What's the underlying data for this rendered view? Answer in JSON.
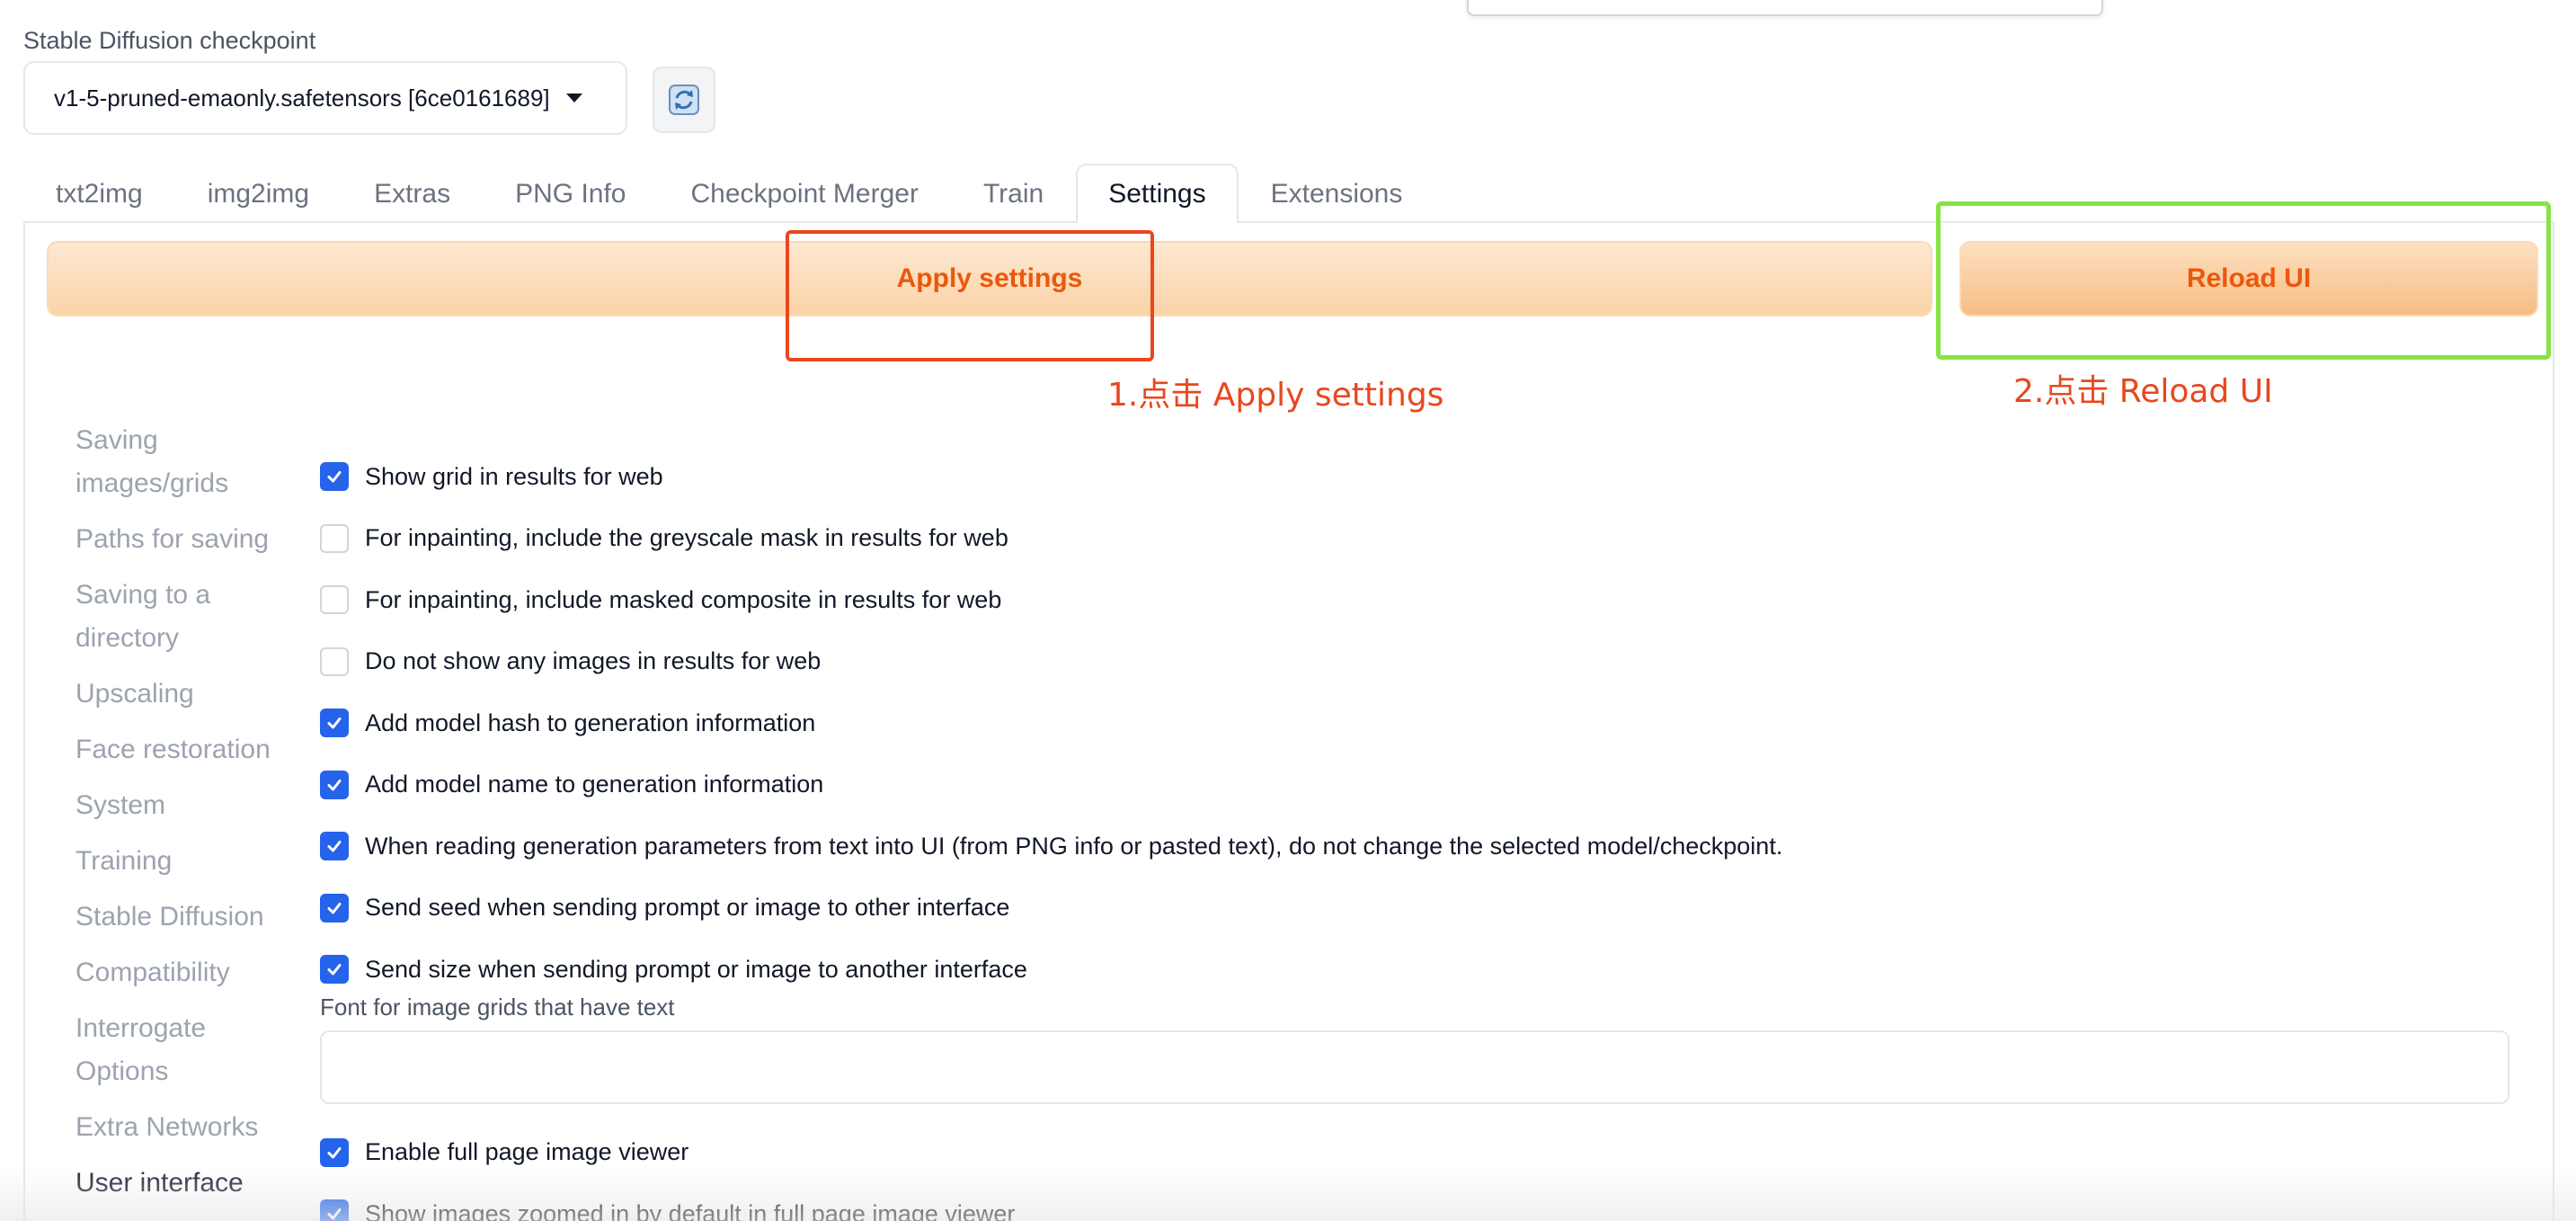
{
  "checkpoint": {
    "label": "Stable Diffusion checkpoint",
    "value": "v1-5-pruned-emaonly.safetensors [6ce0161689]"
  },
  "tabs": [
    {
      "label": "txt2img"
    },
    {
      "label": "img2img"
    },
    {
      "label": "Extras"
    },
    {
      "label": "PNG Info"
    },
    {
      "label": "Checkpoint Merger"
    },
    {
      "label": "Train"
    },
    {
      "label": "Settings",
      "selected": true
    },
    {
      "label": "Extensions"
    }
  ],
  "actions": {
    "apply_label": "Apply settings",
    "reload_label": "Reload UI"
  },
  "annotations": {
    "step1": "1.点击 Apply settings",
    "step2": "2.点击 Reload UI",
    "step1_color": "#e9471e",
    "step2_color": "#86e344"
  },
  "sidebar": [
    {
      "label": "Saving images/grids"
    },
    {
      "label": "Paths for saving"
    },
    {
      "label": "Saving to a directory"
    },
    {
      "label": "Upscaling"
    },
    {
      "label": "Face restoration"
    },
    {
      "label": "System"
    },
    {
      "label": "Training"
    },
    {
      "label": "Stable Diffusion"
    },
    {
      "label": "Compatibility"
    },
    {
      "label": "Interrogate Options"
    },
    {
      "label": "Extra Networks"
    },
    {
      "label": "User interface",
      "active": true
    }
  ],
  "settings": [
    {
      "label": "Show grid in results for web",
      "checked": true
    },
    {
      "label": "For inpainting, include the greyscale mask in results for web",
      "checked": false
    },
    {
      "label": "For inpainting, include masked composite in results for web",
      "checked": false
    },
    {
      "label": "Do not show any images in results for web",
      "checked": false
    },
    {
      "label": "Add model hash to generation information",
      "checked": true
    },
    {
      "label": "Add model name to generation information",
      "checked": true
    },
    {
      "label": "When reading generation parameters from text into UI (from PNG info or pasted text), do not change the selected model/checkpoint.",
      "checked": true
    },
    {
      "label": "Send seed when sending prompt or image to other interface",
      "checked": true
    },
    {
      "label": "Send size when sending prompt or image to another interface",
      "checked": true
    }
  ],
  "font_field": {
    "label": "Font for image grids that have text",
    "value": ""
  },
  "settings_after": [
    {
      "label": "Enable full page image viewer",
      "checked": true
    },
    {
      "label": "Show images zoomed in by default in full page image viewer",
      "checked": true
    }
  ],
  "colors": {
    "accent": "#ea580c",
    "checkbox": "#2563eb"
  }
}
